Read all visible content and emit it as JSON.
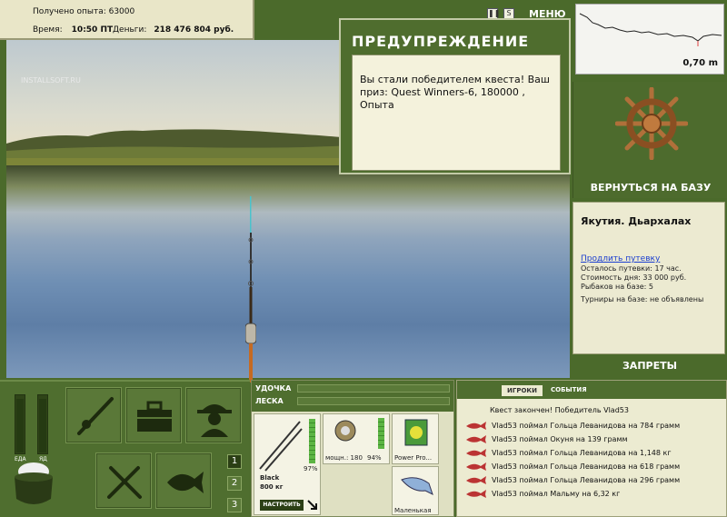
{
  "topinfo": {
    "experience": "Получено опыта: 63000",
    "time_label": "Время:",
    "time_value": "10:50 ПТ",
    "money_label": "Деньги:",
    "money_value": "218 476 804 руб."
  },
  "scene": {
    "watermark": "INSTALLSOFT.RU"
  },
  "top_menu": {
    "pause_icon": "pause-icon",
    "s_label": "S",
    "menu_label": "МЕНЮ"
  },
  "depth": {
    "value": "0,70 m"
  },
  "warning": {
    "title": "ПРЕДУПРЕЖДЕНИЕ",
    "message": "Вы стали победителем квеста! Ваш приз: Quest Winners-6, 180000 , Опыта"
  },
  "helm": {
    "return_label": "ВЕРНУТЬСЯ НА БАЗУ"
  },
  "location": {
    "place": "Якутия. Дьархалах",
    "extend_link": "Продлить путевку",
    "lines": [
      "Осталось путевки: 17 час.",
      "Стоимость дня: 33 000 руб.",
      "Рыбаков на базе: 5",
      "Турниры на базе: не объявлены"
    ]
  },
  "bans": {
    "label": "ЗАПРЕТЫ"
  },
  "needs": {
    "food_label": "ЕДА",
    "poison_label": "ЯД"
  },
  "slots": [
    "1",
    "2",
    "3"
  ],
  "tackle": {
    "rod_label": "УДОЧКА",
    "line_label": "ЛЕСКА",
    "rod_name": "Black",
    "rod_load": "800 кг",
    "rod_percent": "97%",
    "reel_power": "мощн.: 180",
    "reel_percent": "94%",
    "line_name": "Power Pro...",
    "lure_name": "Маленькая",
    "setup_button": "НАСТРОИТЬ",
    "rod_fill": 0.97,
    "reel_fill": 0.94
  },
  "events": {
    "tab_players": "ИГРОКИ",
    "tab_events": "СОБЫТИЯ",
    "quest_result": "Квест закончен! Победитель Vlad53",
    "items": [
      "Vlad53 поймал Гольца Леванидова на 784 грамм",
      "Vlad53 поймал Окуня на 139 грамм",
      "Vlad53 поймал Гольца Леванидова на 1,148 кг",
      "Vlad53 поймал Гольца Леванидова на 618 грамм",
      "Vlad53 поймал Гольца Леванидова на 296 грамм",
      "Vlad53 поймал Мальму на 6,32 кг"
    ]
  }
}
